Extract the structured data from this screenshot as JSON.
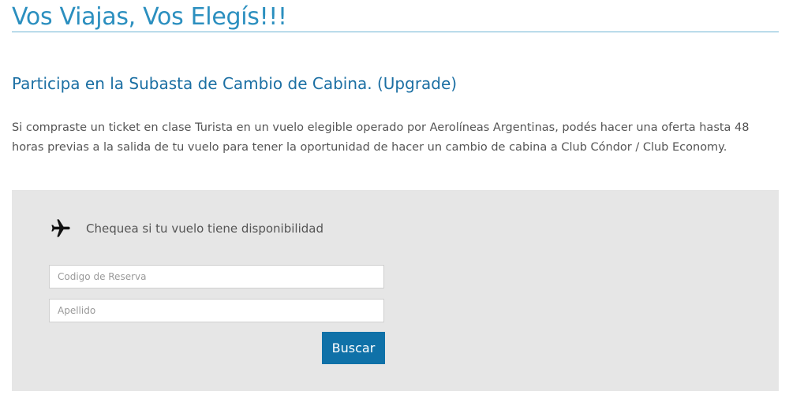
{
  "hero": {
    "title": "Vos Viajas, Vos Elegís!!!"
  },
  "section": {
    "heading": "Participa en la Subasta de Cambio de Cabina. (Upgrade)",
    "description": "Si compraste un ticket en clase Turista en un vuelo elegible operado por Aerolíneas Argentinas, podés hacer una oferta hasta 48 horas previas a la salida de tu vuelo para tener la oportunidad de hacer un cambio de cabina a Club Cóndor / Club Economy."
  },
  "form": {
    "icon": "airplane-icon",
    "title": "Chequea si tu vuelo tiene disponibilidad",
    "reservation_code": {
      "value": "",
      "placeholder": "Codigo de Reserva"
    },
    "surname": {
      "value": "",
      "placeholder": "Apellido"
    },
    "submit_label": "Buscar"
  },
  "colors": {
    "title": "#2b8fbf",
    "heading": "#1b6fa3",
    "body_text": "#555555",
    "panel_bg": "#e6e6e6",
    "button_bg": "#0f71a8",
    "button_text": "#ffffff"
  }
}
